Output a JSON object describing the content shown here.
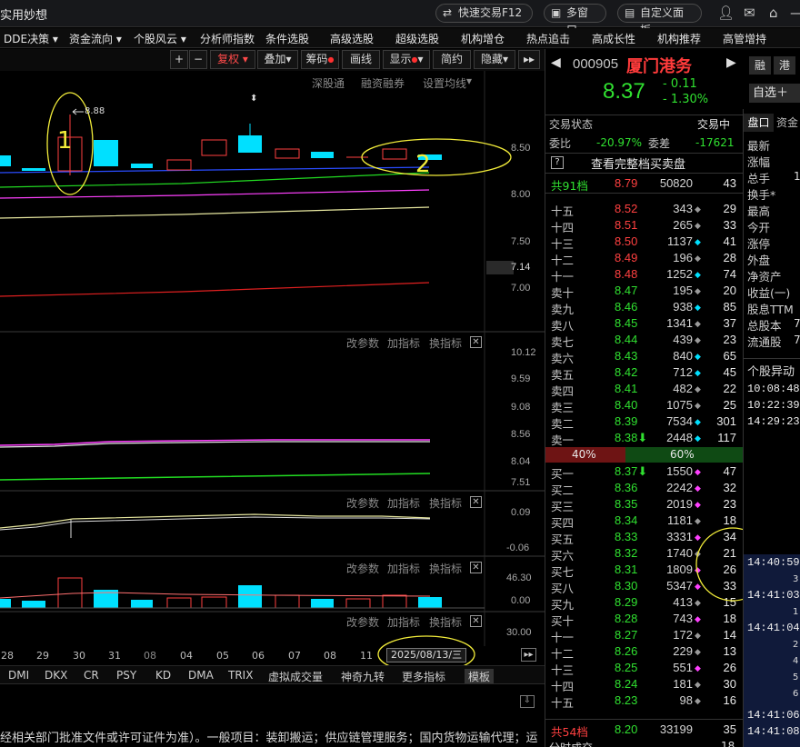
{
  "titlebar": {
    "app_title": "实用妙想",
    "quick_trade": "快速交易F12",
    "multi_window": "多窗口",
    "custom_panel": "自定义面板"
  },
  "menu": [
    "DDE决策 ▾",
    "资金流向 ▾",
    "个股风云 ▾",
    "分析师指数",
    "条件选股",
    "高级选股",
    "超级选股",
    "机构增仓",
    "热点追击",
    "高成长性",
    "机构推荐",
    "高管增持"
  ],
  "toolbar": {
    "plus": "+",
    "minus": "−",
    "fuquan": "复权",
    "overlay": "叠加",
    "chip": "筹码",
    "draw": "画线",
    "display": "显示",
    "simple": "简约",
    "hide": "隐藏",
    "expand": "▸▸"
  },
  "main_chart": {
    "links": [
      "深股通",
      "融资融券",
      "设置均线"
    ],
    "y_ticks": [
      "8.50",
      "8.00",
      "7.50",
      "7.00"
    ],
    "current_price_tag": "7.14",
    "high_label": "8.88",
    "annotation_1": "1",
    "annotation_2": "2"
  },
  "sub_tools": {
    "change_param": "改参数",
    "add_indicator": "加指标",
    "switch_indicator": "换指标",
    "close": "✕"
  },
  "sub1": {
    "y_ticks": [
      "10.12",
      "9.59",
      "9.08",
      "8.56",
      "8.04",
      "7.51"
    ]
  },
  "sub2": {
    "y_ticks": [
      "0.09",
      "-0.06"
    ]
  },
  "sub3": {
    "y_ticks": [
      "46.30",
      "0.00"
    ]
  },
  "sub4": {
    "y_ticks": [
      "30.00"
    ]
  },
  "date_axis": {
    "labels": [
      "28",
      "29",
      "30",
      "31",
      "08",
      "04",
      "05",
      "06",
      "07",
      "08",
      "11"
    ],
    "cursor_date": "2025/08/13/三"
  },
  "indicator_tabs": [
    "DMI",
    "DKX",
    "CR",
    "PSY",
    "KD",
    "DMA",
    "TRIX",
    "虚拟成交量",
    "神奇九转",
    "更多指标",
    "模板"
  ],
  "ticker_text": "经相关部门批准文件或许可证件为准）。一般项目：装卸搬运；供应链管理服务；国内货物运输代理；运",
  "quote": {
    "code": "000905",
    "name": "厦门港务",
    "rong": "融",
    "gang": "港",
    "price": "8.37",
    "change": "- 0.11",
    "pct": "- 1.30%",
    "watchlist": "自选＋",
    "trade_status_label": "交易状态",
    "trade_status": "交易中",
    "weibi_label": "委比",
    "weibi": "-20.97%",
    "weicha_label": "委差",
    "weicha": "-17621",
    "full_book": "查看完整档买卖盘",
    "sell_total_label": "共91档",
    "sell_total_price": "8.79",
    "sell_total_vol": "50820",
    "sell_total_cnt": "43",
    "ratio_sell": "40%",
    "ratio_buy": "60%",
    "buy_total_label": "共54档",
    "buy_total_price": "8.20",
    "buy_total_vol": "33199",
    "buy_total_cnt": "35",
    "bottom_cut": "分时成交",
    "bottom_cnt": "18"
  },
  "sell_book": [
    {
      "label": "十五",
      "price": "8.52",
      "vol": "343",
      "cnt": "29",
      "mark": "diamond-gray"
    },
    {
      "label": "十四",
      "price": "8.51",
      "vol": "265",
      "cnt": "33",
      "mark": "diamond-gray"
    },
    {
      "label": "十三",
      "price": "8.50",
      "vol": "1137",
      "cnt": "41",
      "mark": "diamond-cyan"
    },
    {
      "label": "十二",
      "price": "8.49",
      "vol": "196",
      "cnt": "28",
      "mark": "diamond-gray"
    },
    {
      "label": "十一",
      "price": "8.48",
      "vol": "1252",
      "cnt": "74",
      "mark": "diamond-cyan"
    },
    {
      "label": "卖十",
      "price": "8.47",
      "vol": "195",
      "cnt": "20",
      "mark": "diamond-gray"
    },
    {
      "label": "卖九",
      "price": "8.46",
      "vol": "938",
      "cnt": "85",
      "mark": "diamond-cyan"
    },
    {
      "label": "卖八",
      "price": "8.45",
      "vol": "1341",
      "cnt": "37",
      "mark": "diamond-gray"
    },
    {
      "label": "卖七",
      "price": "8.44",
      "vol": "439",
      "cnt": "23",
      "mark": "diamond-gray"
    },
    {
      "label": "卖六",
      "price": "8.43",
      "vol": "840",
      "cnt": "65",
      "mark": "diamond-cyan"
    },
    {
      "label": "卖五",
      "price": "8.42",
      "vol": "712",
      "cnt": "45",
      "mark": "diamond-cyan"
    },
    {
      "label": "卖四",
      "price": "8.41",
      "vol": "482",
      "cnt": "22",
      "mark": "diamond-gray"
    },
    {
      "label": "卖三",
      "price": "8.40",
      "vol": "1075",
      "cnt": "25",
      "mark": "diamond-gray"
    },
    {
      "label": "卖二",
      "price": "8.39",
      "vol": "7534",
      "cnt": "301",
      "mark": "diamond-cyan"
    },
    {
      "label": "卖一",
      "price": "8.38",
      "vol": "2448",
      "cnt": "117",
      "mark": "diamond-cyan",
      "arrow": "⬇"
    }
  ],
  "buy_book": [
    {
      "label": "买一",
      "price": "8.37",
      "vol": "1550",
      "cnt": "47",
      "mark": "diamond-magenta",
      "arrow": "⬇"
    },
    {
      "label": "买二",
      "price": "8.36",
      "vol": "2242",
      "cnt": "32",
      "mark": "diamond-magenta"
    },
    {
      "label": "买三",
      "price": "8.35",
      "vol": "2019",
      "cnt": "23",
      "mark": "diamond-magenta"
    },
    {
      "label": "买四",
      "price": "8.34",
      "vol": "1181",
      "cnt": "18",
      "mark": "diamond-gray"
    },
    {
      "label": "买五",
      "price": "8.33",
      "vol": "3331",
      "cnt": "34",
      "mark": "diamond-magenta"
    },
    {
      "label": "买六",
      "price": "8.32",
      "vol": "1740",
      "cnt": "21",
      "mark": "diamond-gray"
    },
    {
      "label": "买七",
      "price": "8.31",
      "vol": "1809",
      "cnt": "26",
      "mark": "diamond-magenta"
    },
    {
      "label": "买八",
      "price": "8.30",
      "vol": "5347",
      "cnt": "33",
      "mark": "diamond-magenta"
    },
    {
      "label": "买九",
      "price": "8.29",
      "vol": "413",
      "cnt": "15",
      "mark": "diamond-gray"
    },
    {
      "label": "买十",
      "price": "8.28",
      "vol": "743",
      "cnt": "18",
      "mark": "diamond-magenta"
    },
    {
      "label": "十一",
      "price": "8.27",
      "vol": "172",
      "cnt": "14",
      "mark": "diamond-gray"
    },
    {
      "label": "十二",
      "price": "8.26",
      "vol": "229",
      "cnt": "13",
      "mark": "diamond-gray"
    },
    {
      "label": "十三",
      "price": "8.25",
      "vol": "551",
      "cnt": "26",
      "mark": "diamond-magenta"
    },
    {
      "label": "十四",
      "price": "8.24",
      "vol": "181",
      "cnt": "30",
      "mark": "diamond-gray"
    },
    {
      "label": "十五",
      "price": "8.23",
      "vol": "98",
      "cnt": "16",
      "mark": "diamond-gray"
    }
  ],
  "far_panel": {
    "tab1": "盘口",
    "tab2": "资金",
    "labels": [
      "最新",
      "涨幅",
      "总手",
      "换手*",
      "最高",
      "今开",
      "涨停",
      "外盘",
      "净资产",
      "收益(一)",
      "股息TTM",
      "总股本",
      "流通股"
    ],
    "partial_vals": {
      "总手": "1",
      "总股本": "7",
      "流通股": "7"
    },
    "yidong_title": "个股异动",
    "yidong_times": [
      "10:08:48",
      "10:22:39",
      "14:29:23"
    ],
    "tick_times": [
      "14:40:59",
      "14:41:03",
      "14:41:04",
      "14:41:06",
      "14:41:08"
    ],
    "tick_digits": [
      "3",
      "1",
      "2",
      "4",
      "5",
      "6"
    ]
  },
  "colors": {
    "up": "#ff3b3b",
    "down": "#00e0ff",
    "ma_yellow": "#e8e8a0",
    "ma_green": "#22dd22",
    "ma_blue": "#2a4cff",
    "ma_magenta": "#ff40ff",
    "ma_red": "#e02020",
    "annotation": "#f2ec3a"
  },
  "icons": [
    "search-icon",
    "mail-icon",
    "home-icon",
    "minus-icon",
    "close-icon"
  ]
}
